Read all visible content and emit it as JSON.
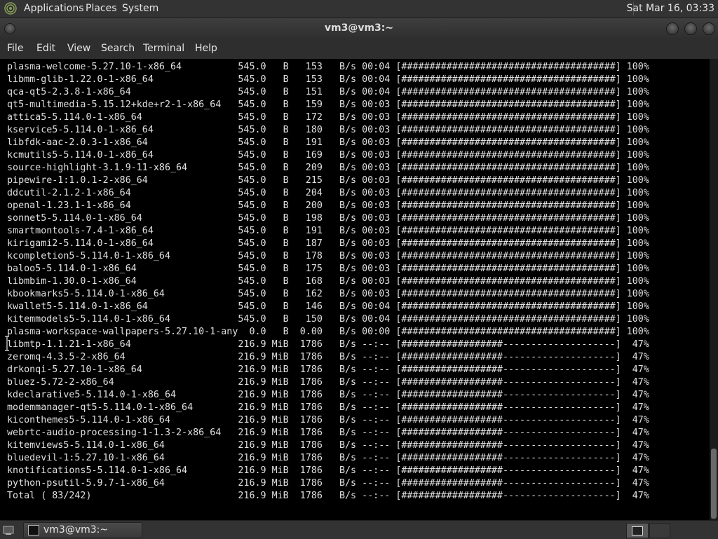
{
  "top_panel": {
    "menus": [
      "Applications",
      "Places",
      "System"
    ],
    "clock": "Sat Mar 16, 03:33"
  },
  "window": {
    "title": "vm3@vm3:~"
  },
  "menubar": {
    "items": [
      "File",
      "Edit",
      "View",
      "Search",
      "Terminal",
      "Help"
    ]
  },
  "terminal": {
    "lines": [
      "plasma-welcome-5.27.10-1-x86_64          545.0   B   153   B/s 00:04 [######################################] 100%",
      "libmm-glib-1.22.0-1-x86_64               545.0   B   153   B/s 00:04 [######################################] 100%",
      "qca-qt5-2.3.8-1-x86_64                   545.0   B   151   B/s 00:04 [######################################] 100%",
      "qt5-multimedia-5.15.12+kde+r2-1-x86_64   545.0   B   159   B/s 00:03 [######################################] 100%",
      "attica5-5.114.0-1-x86_64                 545.0   B   172   B/s 00:03 [######################################] 100%",
      "kservice5-5.114.0-1-x86_64               545.0   B   180   B/s 00:03 [######################################] 100%",
      "libfdk-aac-2.0.3-1-x86_64                545.0   B   191   B/s 00:03 [######################################] 100%",
      "kcmutils5-5.114.0-1-x86_64               545.0   B   169   B/s 00:03 [######################################] 100%",
      "source-highlight-3.1.9-11-x86_64         545.0   B   209   B/s 00:03 [######################################] 100%",
      "pipewire-1:1.0.1-2-x86_64                545.0   B   215   B/s 00:03 [######################################] 100%",
      "ddcutil-2.1.2-1-x86_64                   545.0   B   204   B/s 00:03 [######################################] 100%",
      "openal-1.23.1-1-x86_64                   545.0   B   200   B/s 00:03 [######################################] 100%",
      "sonnet5-5.114.0-1-x86_64                 545.0   B   198   B/s 00:03 [######################################] 100%",
      "smartmontools-7.4-1-x86_64               545.0   B   191   B/s 00:03 [######################################] 100%",
      "kirigami2-5.114.0-1-x86_64               545.0   B   187   B/s 00:03 [######################################] 100%",
      "kcompletion5-5.114.0-1-x86_64            545.0   B   178   B/s 00:03 [######################################] 100%",
      "baloo5-5.114.0-1-x86_64                  545.0   B   175   B/s 00:03 [######################################] 100%",
      "libmbim-1.30.0-1-x86_64                  545.0   B   168   B/s 00:03 [######################################] 100%",
      "kbookmarks5-5.114.0-1-x86_64             545.0   B   162   B/s 00:03 [######################################] 100%",
      "kwallet5-5.114.0-1-x86_64                545.0   B   146   B/s 00:04 [######################################] 100%",
      "kitemmodels5-5.114.0-1-x86_64            545.0   B   150   B/s 00:04 [######################################] 100%",
      "plasma-workspace-wallpapers-5.27.10-1-any  0.0   B  0.00   B/s 00:00 [######################################] 100%",
      "libmtp-1.1.21-1-x86_64                   216.9 MiB  1786   B/s --:-- [##################--------------------]  47%",
      "zeromq-4.3.5-2-x86_64                    216.9 MiB  1786   B/s --:-- [##################--------------------]  47%",
      "drkonqi-5.27.10-1-x86_64                 216.9 MiB  1786   B/s --:-- [##################--------------------]  47%",
      "bluez-5.72-2-x86_64                      216.9 MiB  1786   B/s --:-- [##################--------------------]  47%",
      "kdeclarative5-5.114.0-1-x86_64           216.9 MiB  1786   B/s --:-- [##################--------------------]  47%",
      "modemmanager-qt5-5.114.0-1-x86_64        216.9 MiB  1786   B/s --:-- [##################--------------------]  47%",
      "kiconthemes5-5.114.0-1-x86_64            216.9 MiB  1786   B/s --:-- [##################--------------------]  47%",
      "webrtc-audio-processing-1-1.3-2-x86_64   216.9 MiB  1786   B/s --:-- [##################--------------------]  47%",
      "kitemviews5-5.114.0-1-x86_64             216.9 MiB  1786   B/s --:-- [##################--------------------]  47%",
      "bluedevil-1:5.27.10-1-x86_64             216.9 MiB  1786   B/s --:-- [##################--------------------]  47%",
      "knotifications5-5.114.0-1-x86_64         216.9 MiB  1786   B/s --:-- [##################--------------------]  47%",
      "python-psutil-5.9.7-1-x86_64             216.9 MiB  1786   B/s --:-- [##################--------------------]  47%",
      "Total ( 83/242)                          216.9 MiB  1786   B/s --:-- [##################--------------------]  47%"
    ]
  },
  "taskbar": {
    "task_label": "vm3@vm3:~"
  },
  "colors": {
    "terminal_bg": "#000000",
    "terminal_fg": "#e0e0e0",
    "panel_bg": "#333333"
  }
}
